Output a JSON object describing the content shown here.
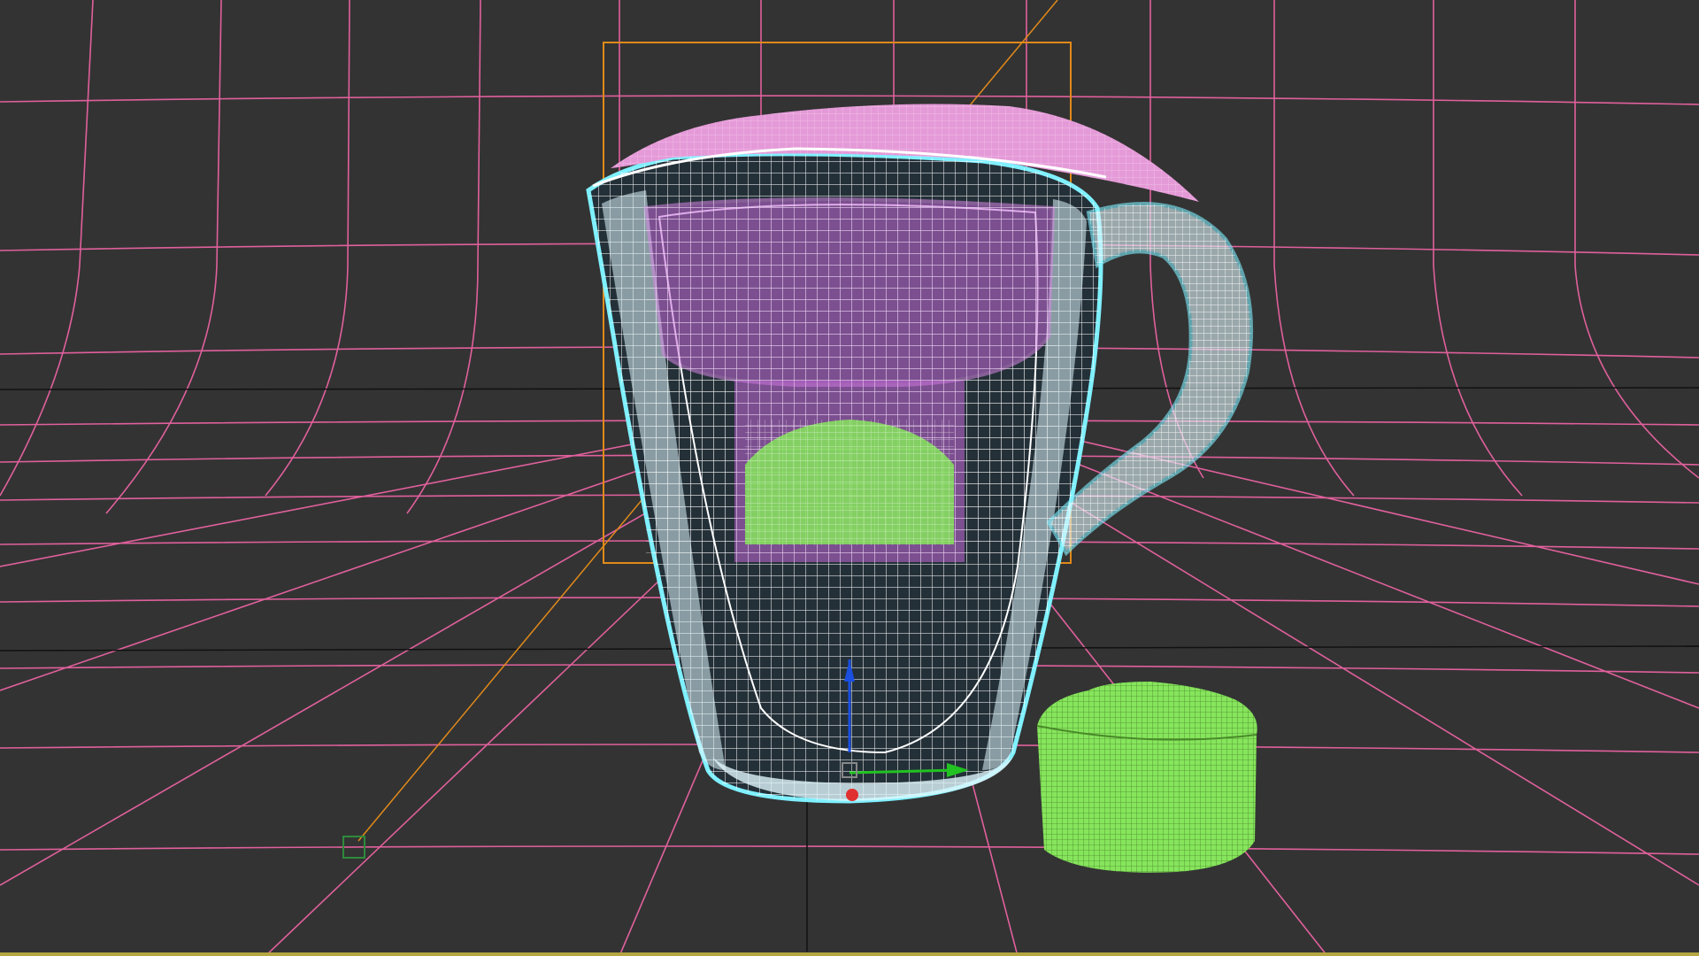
{
  "viewport": {
    "background_color": "#333333",
    "grid_color": "#e0609c",
    "horizon_line_color": "#111111",
    "border_bottom_color": "#b5a642",
    "render_mode": "wireframe"
  },
  "objects": [
    {
      "name": "water-pitcher",
      "wire_color": "#ffffff",
      "outline_color": "#7ff0ff",
      "selected": true
    },
    {
      "name": "pitcher-lid",
      "wire_color": "#ffffff",
      "fill_color": "#e59ad8"
    },
    {
      "name": "pitcher-reservoir",
      "wire_color": "#ffffff",
      "fill_color": "#c46ad8"
    },
    {
      "name": "filter-cartridge-inside",
      "wire_color": "#ffffff",
      "fill_color": "#86e55c"
    },
    {
      "name": "filter-cartridge",
      "wire_color": "#4a8a2a",
      "fill_color": "#86e55c"
    },
    {
      "name": "camera-target",
      "line_color": "#e08a1a"
    },
    {
      "name": "selection-bracket",
      "line_color": "#e08a1a"
    }
  ],
  "gizmo": {
    "axis_x_color": "#21c221",
    "axis_y_color": "#1a4fe0",
    "pivot_color": "#e03030"
  }
}
